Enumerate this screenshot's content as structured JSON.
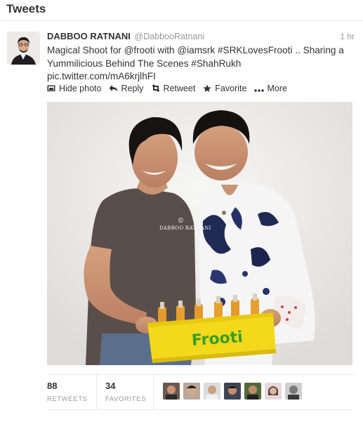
{
  "header": {
    "title": "Tweets"
  },
  "tweet": {
    "fullname": "DABBOO RATNANI",
    "username": "@DabbooRatnani",
    "time": "1 hr",
    "text_parts": {
      "p1": "Magical Shoot for ",
      "mention1": "@frooti",
      "p2": " with ",
      "mention2": "@iamsrk",
      "p3": " ",
      "hashtag1": "#SRKLovesFrooti",
      "p4": " .. Sharing a Yummilicious Behind The Scenes ",
      "hashtag2": "#ShahRukh",
      "link": "pic.twitter.com/mA6krjlhFI"
    },
    "actions": [
      {
        "label": "Hide photo",
        "icon": "photo-icon"
      },
      {
        "label": "Reply",
        "icon": "reply-icon"
      },
      {
        "label": "Retweet",
        "icon": "retweet-icon"
      },
      {
        "label": "Favorite",
        "icon": "star-icon"
      },
      {
        "label": "More",
        "icon": "more-dots-icon"
      }
    ],
    "photo": {
      "watermark_symbol": "©",
      "watermark_text": "DABBOO RATNANI",
      "crate_brand": "Frooti"
    }
  },
  "stats": {
    "retweets_count": "88",
    "retweets_label": "RETWEETS",
    "favorites_count": "34",
    "favorites_label": "FAVORITES"
  },
  "colors": {
    "text": "#333333",
    "muted": "#999999",
    "divider": "#e8e8e8",
    "crate_yellow": "#f2d91c",
    "brand_green": "#3a9d23"
  }
}
